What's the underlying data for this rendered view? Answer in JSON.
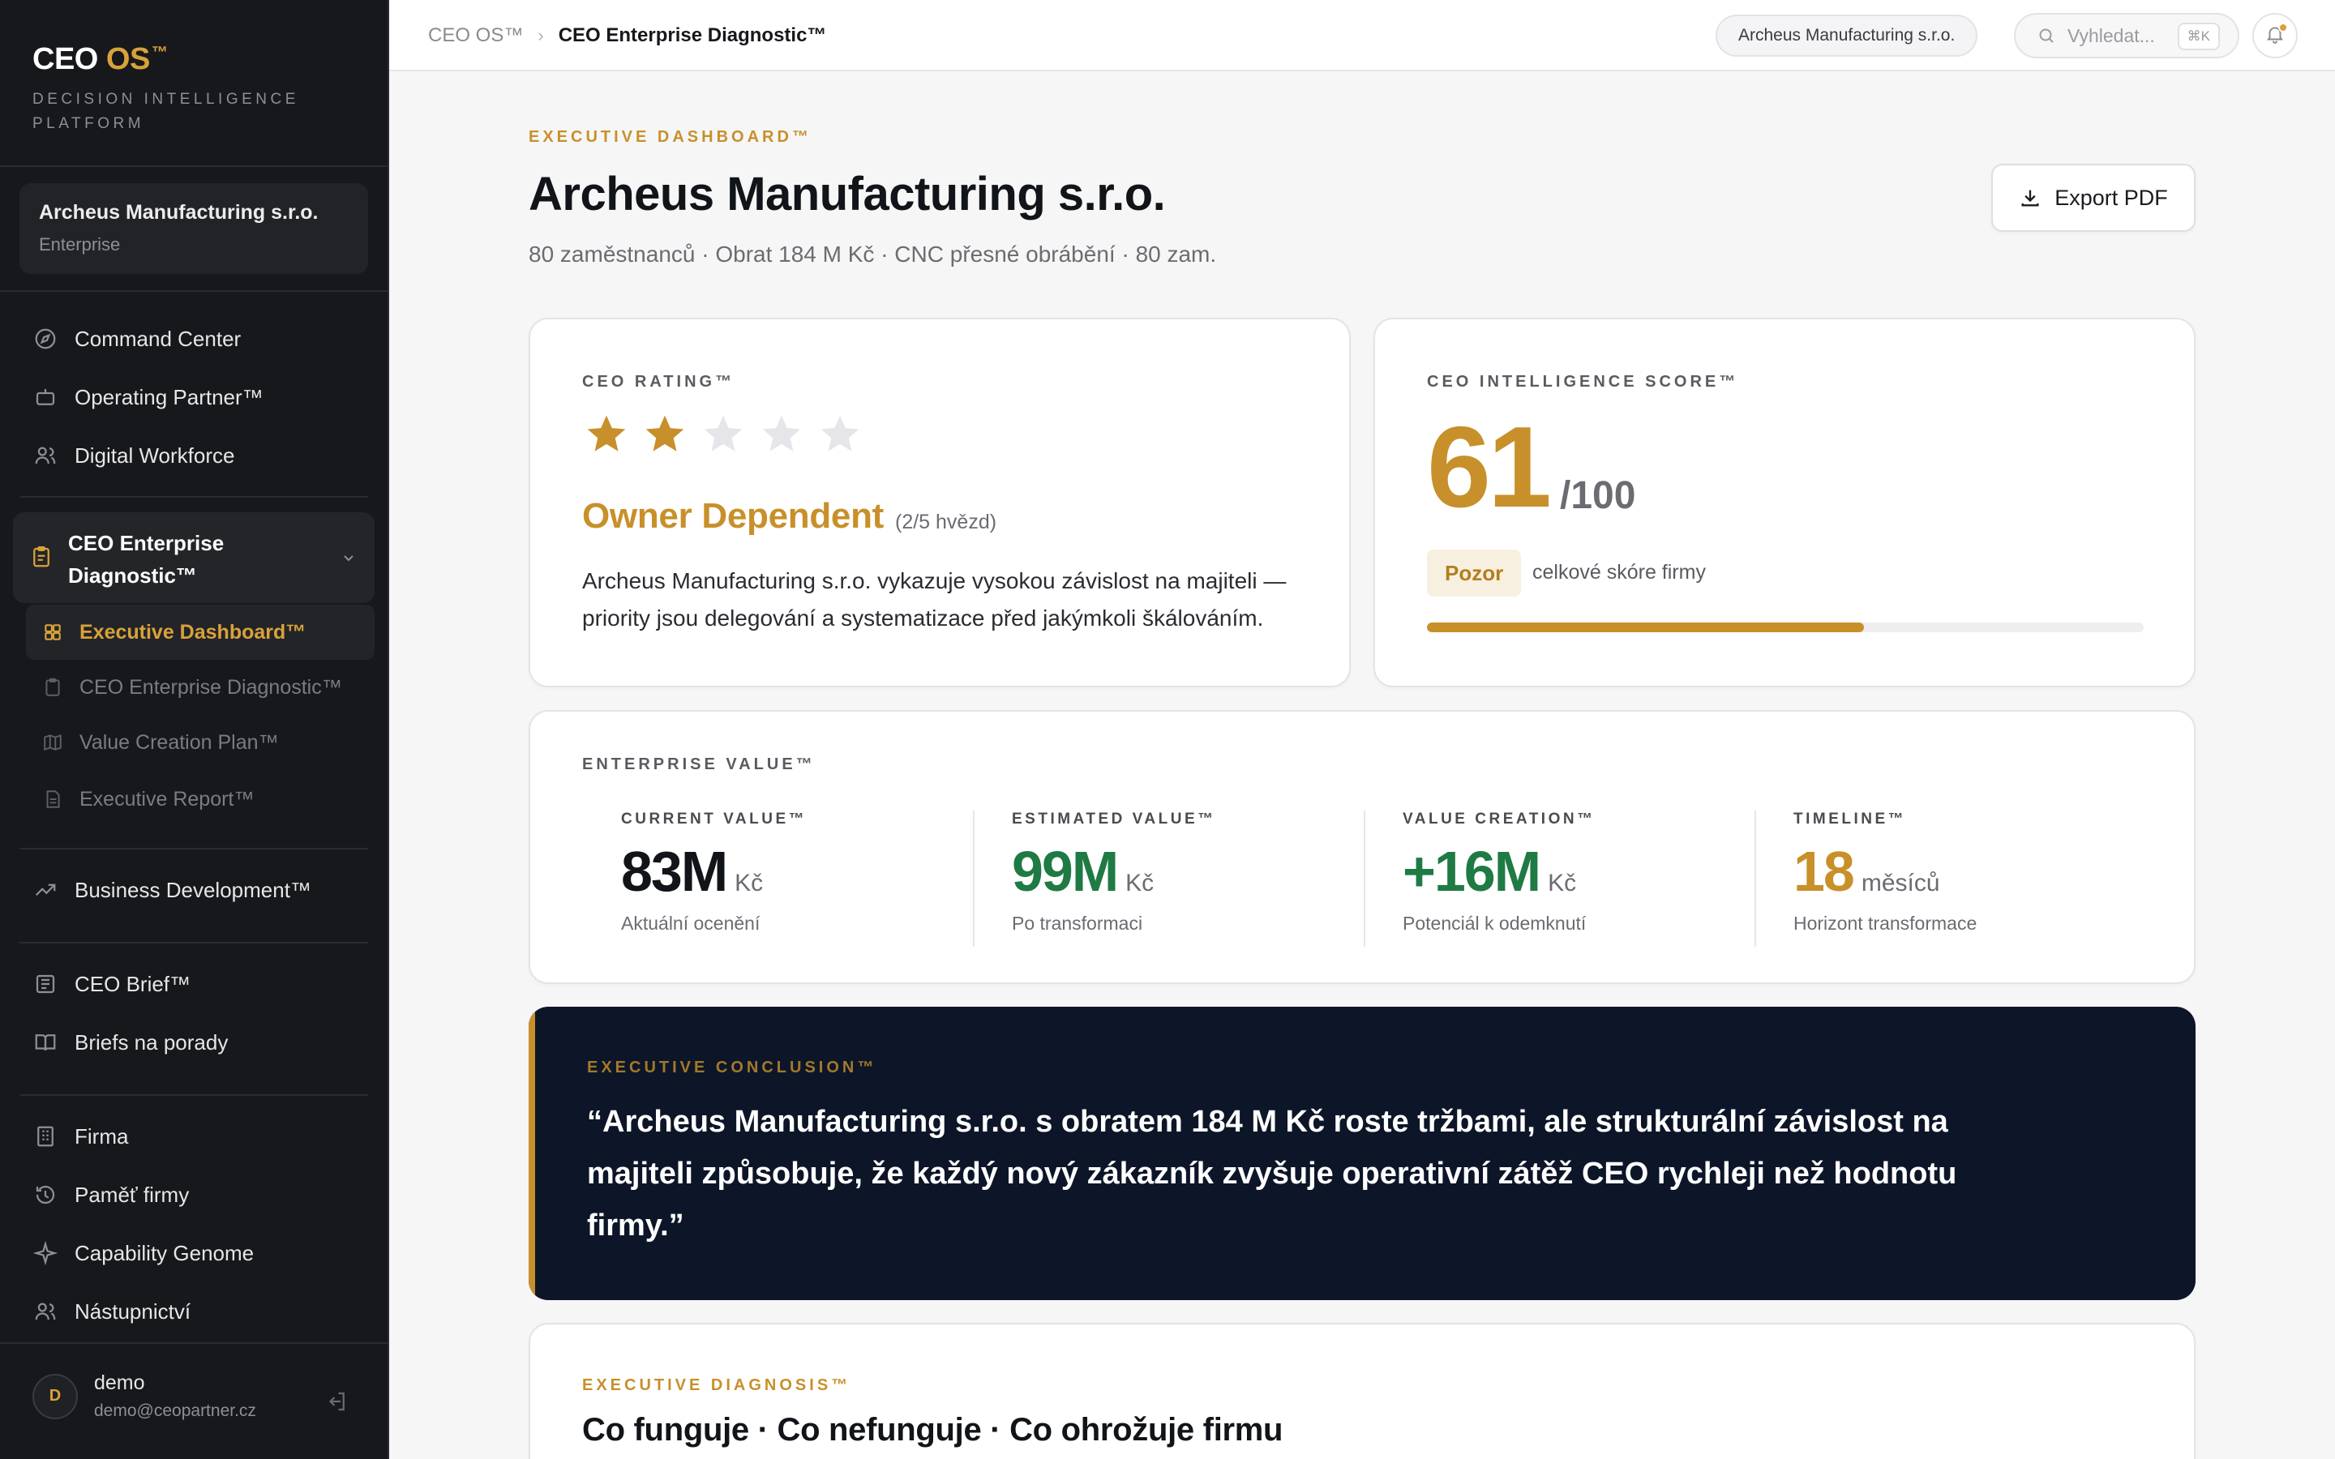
{
  "sidebar": {
    "brand_ceo": "CEO",
    "brand_os": "OS",
    "brand_tm": "™",
    "brand_subtitle": "DECISION INTELLIGENCE PLATFORM",
    "company": {
      "name": "Archeus Manufacturing s.r.o.",
      "tier": "Enterprise"
    },
    "nav_top": [
      {
        "label": "Command Center",
        "icon": "compass-icon"
      },
      {
        "label": "Operating Partner™",
        "icon": "robot-icon"
      },
      {
        "label": "Digital Workforce",
        "icon": "users-icon"
      }
    ],
    "group": {
      "label": "CEO Enterprise Diagnostic™",
      "icon": "clipboard-icon",
      "expanded": true,
      "items": [
        {
          "label": "Executive Dashboard™",
          "icon": "grid-icon",
          "active": true
        },
        {
          "label": "CEO Enterprise Diagnostic™",
          "icon": "clipboard-icon",
          "active": false
        },
        {
          "label": "Value Creation Plan™",
          "icon": "map-icon",
          "active": false
        },
        {
          "label": "Executive Report™",
          "icon": "document-icon",
          "active": false
        }
      ]
    },
    "nav_bizdev": {
      "label": "Business Development™",
      "icon": "trend-up-icon"
    },
    "nav_briefs": [
      {
        "label": "CEO Brief™",
        "icon": "newspaper-icon"
      },
      {
        "label": "Briefs na porady",
        "icon": "book-icon"
      }
    ],
    "nav_company": [
      {
        "label": "Firma",
        "icon": "building-icon"
      },
      {
        "label": "Paměť firmy",
        "icon": "history-icon"
      },
      {
        "label": "Capability Genome",
        "icon": "sparkle-icon"
      },
      {
        "label": "Nástupnictví",
        "icon": "users-icon"
      }
    ],
    "user": {
      "initial": "D",
      "name": "demo",
      "email": "demo@ceopartner.cz"
    }
  },
  "topbar": {
    "breadcrumb": [
      "CEO OS™",
      "CEO Enterprise Diagnostic™"
    ],
    "company_chip": "Archeus Manufacturing s.r.o.",
    "search_placeholder": "Vyhledat...",
    "search_shortcut": "⌘K"
  },
  "header": {
    "eyebrow": "EXECUTIVE DASHBOARD™",
    "title": "Archeus Manufacturing s.r.o.",
    "subtitle": "80 zaměstnanců · Obrat 184 M Kč · CNC přesné obrábění · 80 zam.",
    "export_label": "Export PDF"
  },
  "rating": {
    "label": "CEO RATING™",
    "stars_filled": 2,
    "stars_total": 5,
    "name": "Owner Dependent",
    "count_text": "(2/5 hvězd)",
    "description": "Archeus Manufacturing s.r.o. vykazuje vysokou závislost na majiteli — priority jsou delegování a systematizace před jakýmkoli škálováním."
  },
  "score": {
    "label": "CEO INTELLIGENCE SCORE™",
    "value": "61",
    "max": "/100",
    "status": "Pozor",
    "note": "celkové skóre firmy",
    "progress": 0.61
  },
  "enterprise_value": {
    "label": "ENTERPRISE VALUE™",
    "metrics": [
      {
        "label": "CURRENT VALUE™",
        "value": "83M",
        "unit": "Kč",
        "note": "Aktuální ocenění",
        "color": "#111418"
      },
      {
        "label": "ESTIMATED VALUE™",
        "value": "99M",
        "unit": "Kč",
        "note": "Po transformaci",
        "color": "#1f7a44"
      },
      {
        "label": "VALUE CREATION™",
        "value": "+16M",
        "unit": "Kč",
        "note": "Potenciál k odemknutí",
        "color": "#1f7a44"
      },
      {
        "label": "TIMELINE™",
        "value": "18",
        "unit": "měsíců",
        "note": "Horizont transformace",
        "color": "#c8902a"
      }
    ]
  },
  "conclusion": {
    "label": "EXECUTIVE CONCLUSION™",
    "text": "“Archeus Manufacturing s.r.o. s obratem 184 M Kč roste tržbami, ale strukturální závislost na majiteli způsobuje, že každý nový zákazník zvyšuje operativní zátěž CEO rychleji než hodnotu firmy.”"
  },
  "diagnosis": {
    "label": "EXECUTIVE DIAGNOSIS™",
    "title": "Co funguje · Co nefunguje · Co ohrožuje firmu"
  },
  "colors": {
    "accent": "#c8902a",
    "positive": "#1f7a44",
    "sidebar_bg": "#17181b",
    "conclusion_bg": "#0d1628"
  }
}
